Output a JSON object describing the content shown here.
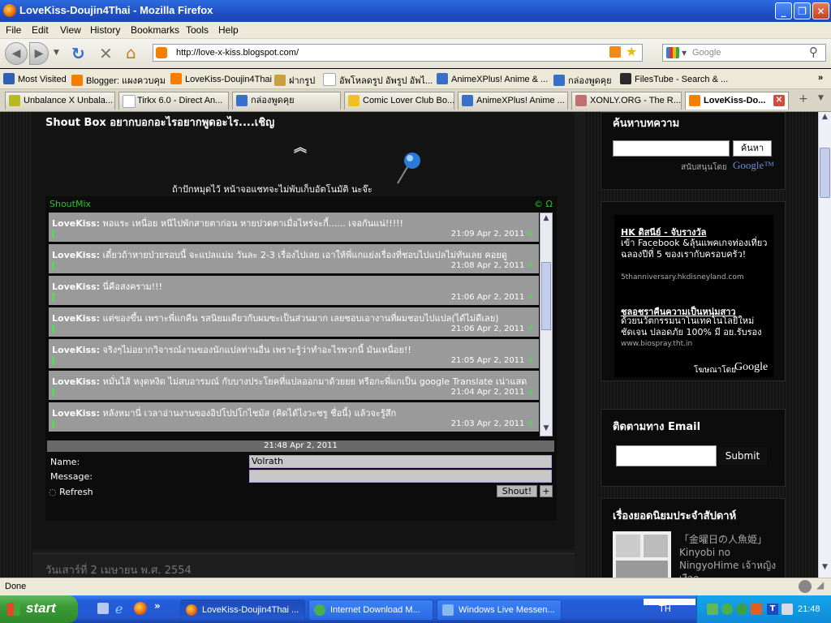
{
  "window": {
    "title": "LoveKiss-Doujin4Thai - Mozilla Firefox"
  },
  "menu": [
    "File",
    "Edit",
    "View",
    "History",
    "Bookmarks",
    "Tools",
    "Help"
  ],
  "nav": {
    "url": "http://love-x-kiss.blogspot.com/",
    "search_placeholder": "Google"
  },
  "bookmarks": [
    {
      "label": "Most Visited",
      "color": "#2f5fb7"
    },
    {
      "label": "Blogger: แผงควบคุม",
      "color": "#f57d00"
    },
    {
      "label": "LoveKiss-Doujin4Thai",
      "color": "#f57d00"
    },
    {
      "label": "ฝากรูป",
      "color": "#c9a040"
    },
    {
      "label": "อัพโหลดรูป อัพรูป อัพไ...",
      "color": "#9aa8c8"
    },
    {
      "label": "AnimeXPlus! Anime & ...",
      "color": "#3a6fc8"
    },
    {
      "label": "กล่องพูดคุย",
      "color": "#3a6fc8"
    },
    {
      "label": "FilesTube - Search & ...",
      "color": "#2a2a2a"
    }
  ],
  "tabs": [
    {
      "label": "Unbalance X Unbala...",
      "color": "#b8b820"
    },
    {
      "label": "Tirkx 6.0 - Direct An...",
      "color": "#9aa8c8"
    },
    {
      "label": "กล่องพูดคุย",
      "color": "#3a6fc8"
    },
    {
      "label": "Comic Lover Club Bo...",
      "color": "#f0c020"
    },
    {
      "label": "AnimeXPlus! Anime ...",
      "color": "#3a6fc8"
    },
    {
      "label": "XONLY.ORG - The R...",
      "color": "#c07070"
    },
    {
      "label": "LoveKiss-Do...",
      "color": "#f57d00"
    }
  ],
  "shoutbox": {
    "title": "Shout Box อยากบอกอะไรอยากพูดอะไร....เชิญ",
    "notice": "ถ้าปักหมุดไว้ หน้าจอแชทจะไม่พับเก็บอัตโนมัติ นะจ๊ะ",
    "brand": "ShoutMix",
    "brand_right": "© Ω",
    "messages": [
      {
        "user": "LoveKiss:",
        "text": "พอแระ เหนื่อย หนีไปพักสายตาก่อน หายปวดตาเมื่อไหร่จะกี้...... เจอกันแน่!!!!!",
        "time": "21:09 Apr 2, 2011"
      },
      {
        "user": "LoveKiss:",
        "text": "เดี๋ยวถ้าหายป่วยรอบนี้ จะแปลแม่ม วันละ 2-3 เรื่องไปเลย เอาให้พี่แกแย่งเรื่องที่ชอบไปแปลไม่ทันเลย คอยดู",
        "time": "21:08 Apr 2, 2011"
      },
      {
        "user": "LoveKiss:",
        "text": "นี่คือสงคราม!!!",
        "time": "21:06 Apr 2, 2011"
      },
      {
        "user": "LoveKiss:",
        "text": "แต่ของขึ้น เพราะพี่แกคีน รสนิยมเดียวกับผมซะเป็นส่วนมาก เลยชอบเอางานที่ผมชอบไปแปล(ได้ไม่ดีเลย)",
        "time": "21:06 Apr 2, 2011"
      },
      {
        "user": "LoveKiss:",
        "text": "จริงๆไม่อยากวิจารณ์งานของนักแปลท่านอื่น เพราะรู้ว่าทำอะไรพวกนี้ มันเหนื่อย!!",
        "time": "21:05 Apr 2, 2011"
      },
      {
        "user": "LoveKiss:",
        "text": "หมั่นไส้ หงุดหงิด ไม่สบอารมณ์ กับบางประโยคที่แปลออกมาด้วยยย หรือกะพี่แกเป็น google Translate เน่าแสด",
        "time": "21:04 Apr 2, 2011"
      },
      {
        "user": "LoveKiss:",
        "text": "หลังหมานี่ เวลาอ่านงานของอิปโปปโกไชมัส (คิดได้ไงวะชรู ชื่อนี้) แล้วจะรู้สึก",
        "time": "21:03 Apr 2, 2011"
      }
    ],
    "current_time": "21:48 Apr 2, 2011",
    "name_label": "Name:",
    "name_value": "Volrath",
    "message_label": "Message:",
    "refresh_label": "Refresh",
    "shout_label": "Shout!",
    "plus_label": "+"
  },
  "date_header": "วันเสาร์ที่ 2 เมษายน พ.ศ. 2554",
  "sidebar": {
    "search_title": "ค้นหาบทความ",
    "search_button": "ค้นหา",
    "powered_by": "สนับสนุนโดย",
    "google": "Google™",
    "ads": [
      {
        "title": "HK ดิสนีย์ - จับรางวัล",
        "body": "เข้า Facebook &ลุ้นแพคเกจท่องเที่ยว ฉลองปีที่ 5 ของเรากับครอบครัว!",
        "url": "5thanniversary.hkdisneyland.com"
      },
      {
        "title": "ชลอชราคืนความเป็นหนุ่มสาว",
        "body": "ด้วยนวัตกรรมนาโนเทคโนโลยีใหม่ ชัดเจน ปลอดภัย 100% มี อย.รับรอง",
        "url": "www.biospray.tht.in"
      }
    ],
    "ads_by": "โฆษณาโดย",
    "ads_google": "Google",
    "email_title": "ติดตามทาง Email",
    "email_submit": "Submit",
    "popular_title": "เรื่องยอดนิยมประจำสัปดาห์",
    "popular_item": "「金曜日の人魚姫」Kinyobi no NingyoHime เจ้าหญิงเงือก..."
  },
  "status": {
    "text": "Done"
  },
  "taskbar": {
    "start": "start",
    "tasks": [
      "LoveKiss-Doujin4Thai ...",
      "Internet Download M...",
      "Windows Live Messen..."
    ],
    "lang": "TH",
    "clock": "21:48"
  }
}
